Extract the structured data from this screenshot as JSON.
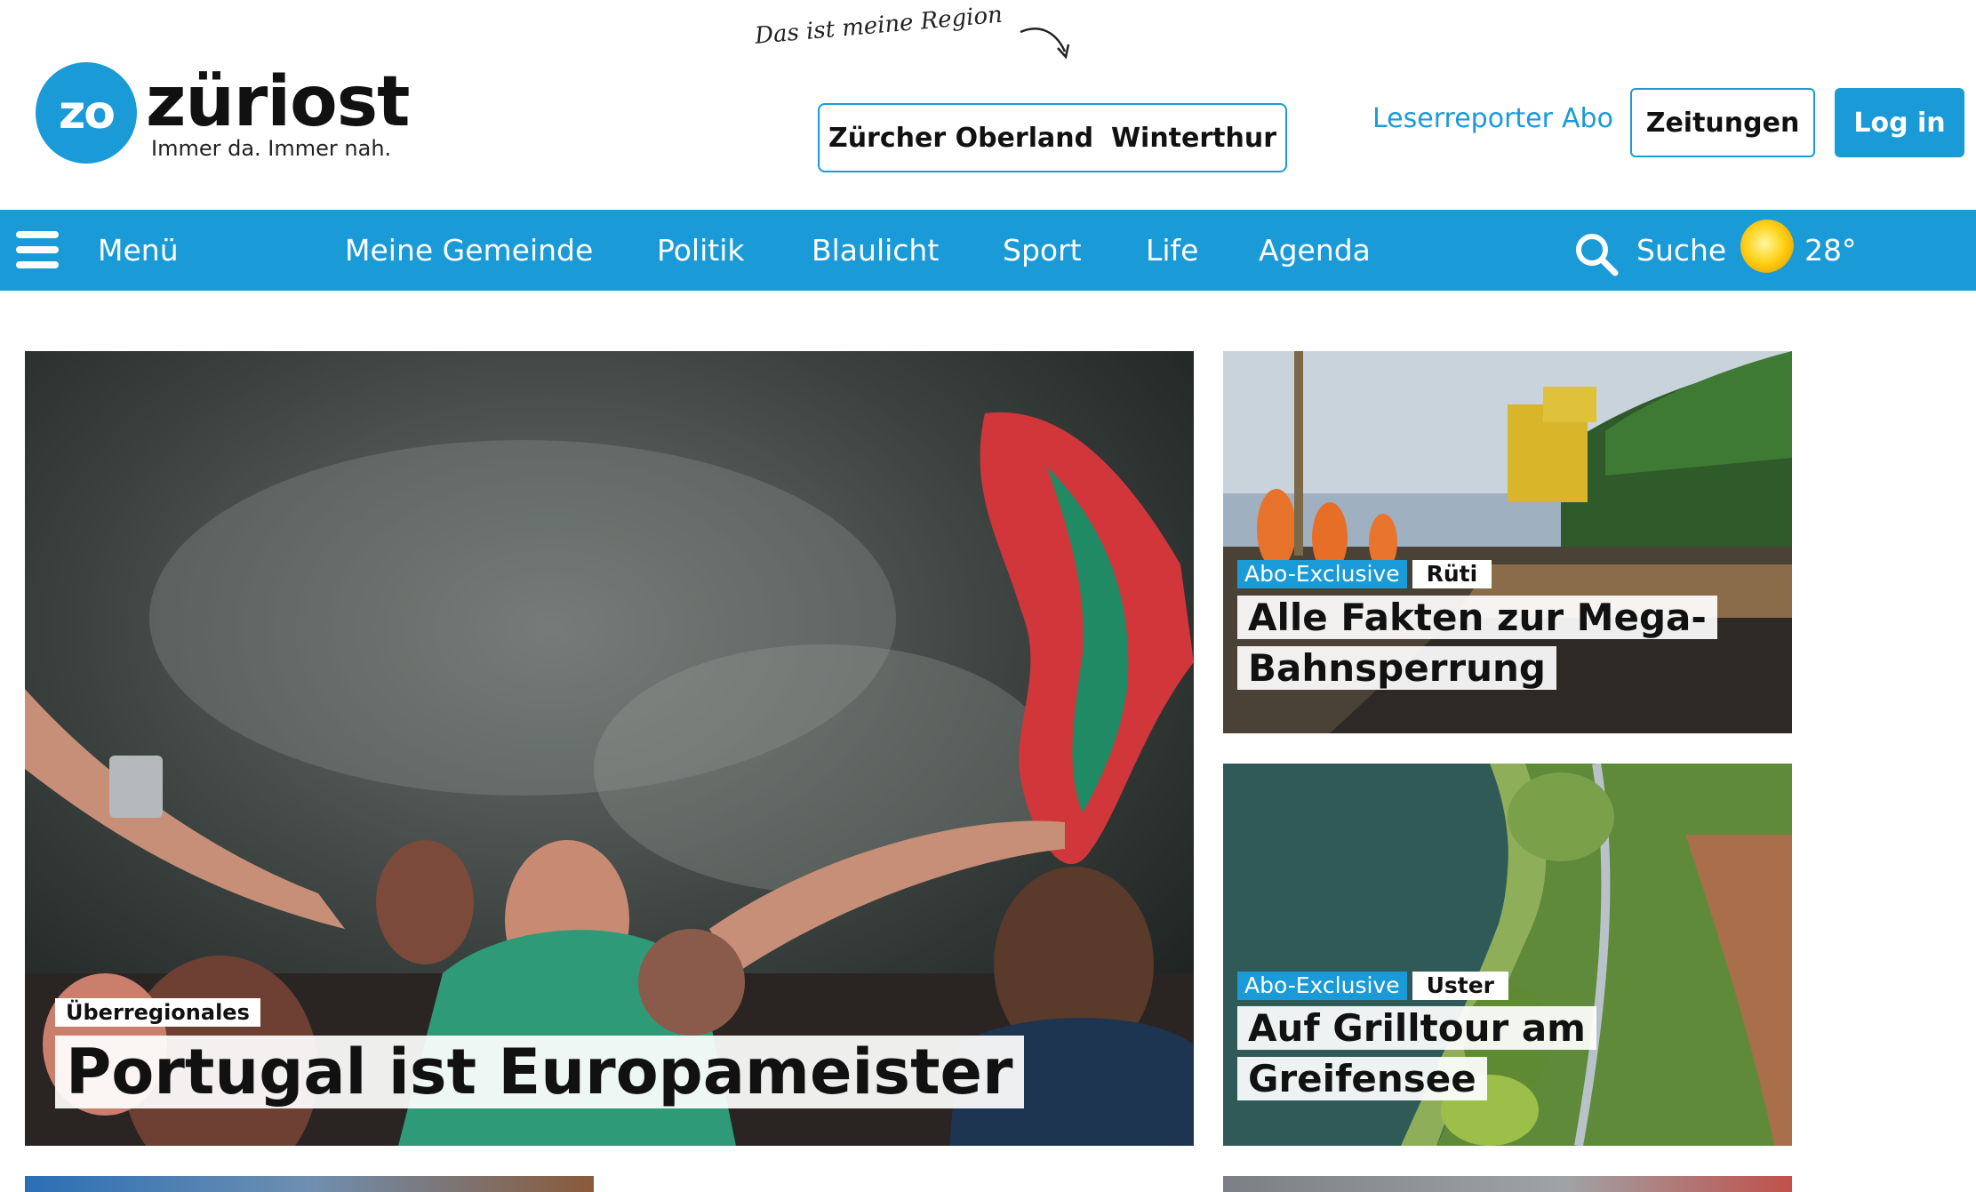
{
  "header": {
    "logo_mark": "zo",
    "logo_name": "züriost",
    "logo_tagline": "Immer da. Immer nah.",
    "region_note": "Das ist meine Region",
    "regions": [
      "Zürcher Oberland",
      "Winterthur"
    ],
    "links": [
      "Leserreporter",
      "Abo"
    ],
    "zeitungen_label": "Zeitungen",
    "login_label": "Log in"
  },
  "nav": {
    "menu_label": "Menü",
    "items": [
      "Meine Gemeinde",
      "Politik",
      "Blaulicht",
      "Sport",
      "Life",
      "Agenda"
    ],
    "search_label": "Suche",
    "weather_temp": "28°"
  },
  "articles": {
    "main": {
      "kicker": "Überregionales",
      "title": "Portugal ist Europameister"
    },
    "side1": {
      "badge": "Abo-Exclusive",
      "place": "Rüti",
      "title": "Alle Fakten zur Mega-Bahnsperrung"
    },
    "side2": {
      "badge": "Abo-Exclusive",
      "place": "Uster",
      "title": "Auf Grilltour am Greifensee"
    }
  },
  "colors": {
    "brand": "#1a9ad6",
    "text": "#111111",
    "nav_text": "#ffffff"
  },
  "icons": {
    "menu": "hamburger-icon",
    "search": "search-icon",
    "weather": "sun-icon",
    "region_arrow": "curved-arrow-icon"
  }
}
